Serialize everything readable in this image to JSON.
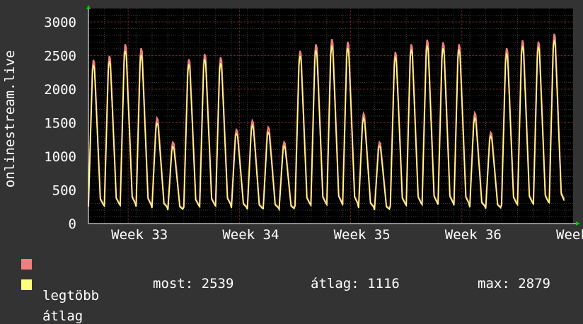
{
  "chart_data": {
    "type": "area",
    "ylabel": "onlinestream.live",
    "y_ticks": [
      0,
      500,
      1000,
      1500,
      2000,
      2500,
      3000
    ],
    "ylim": [
      0,
      3200
    ],
    "x_ticks": [
      "Week 33",
      "Week 34",
      "Week 35",
      "Week 36",
      "Week"
    ],
    "grid": true,
    "series": [
      {
        "name": "legtöbb",
        "color": "#f08080",
        "daily_peaks": [
          2520,
          2580,
          2760,
          2700,
          1620,
          1250,
          2530,
          2610,
          2560,
          1440,
          1580,
          1480,
          1250,
          2660,
          2760,
          2840,
          2800,
          1690,
          1250,
          2640,
          2760,
          2830,
          2790,
          2760,
          1700,
          1400,
          2700,
          2820,
          2800,
          2920
        ],
        "daily_troughs": [
          260,
          270,
          280,
          260,
          240,
          210,
          250,
          260,
          270,
          240,
          220,
          230,
          220,
          270,
          280,
          290,
          280,
          240,
          210,
          270,
          280,
          290,
          290,
          280,
          250,
          230,
          280,
          290,
          300,
          330
        ]
      },
      {
        "name": "átlag",
        "color": "#ffff80",
        "daily_peaks": [
          2440,
          2500,
          2660,
          2600,
          1540,
          1180,
          2450,
          2530,
          2470,
          1380,
          1510,
          1400,
          1190,
          2580,
          2670,
          2740,
          2700,
          1620,
          1190,
          2570,
          2680,
          2740,
          2700,
          2680,
          1620,
          1340,
          2620,
          2730,
          2720,
          2820
        ],
        "daily_troughs": [
          250,
          260,
          270,
          250,
          230,
          200,
          240,
          250,
          260,
          230,
          210,
          220,
          210,
          260,
          270,
          280,
          270,
          230,
          200,
          260,
          270,
          280,
          280,
          270,
          240,
          220,
          270,
          280,
          290,
          310
        ]
      }
    ]
  },
  "legend": {
    "max_label": "legtöbb",
    "avg_label": "átlag",
    "max_color": "#f08080",
    "avg_color": "#ffff80"
  },
  "stats": {
    "now": "most: 2539",
    "avg": "átlag: 1116",
    "max": "max: 2879"
  }
}
